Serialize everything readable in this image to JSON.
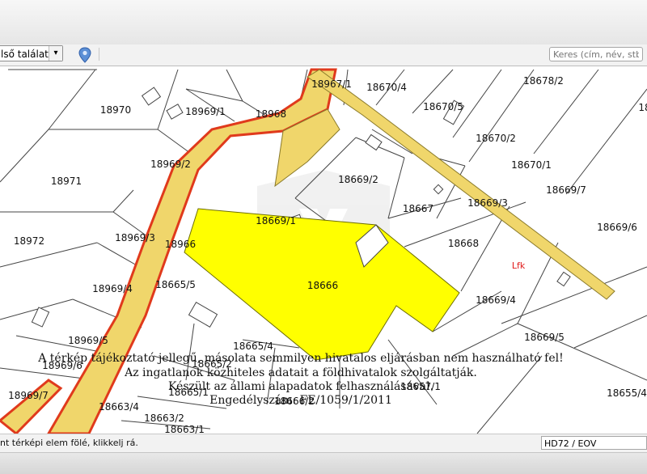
{
  "toolbar": {
    "select_value": "lső találat",
    "search_placeholder": "Keres (cím, név, stb.)",
    "icons": {
      "select_arrow": "chevron-down-icon",
      "location": "map-pin-icon"
    }
  },
  "map": {
    "parcels": [
      "18967/1",
      "18670/4",
      "18678/2",
      "18970",
      "18969/1",
      "18968",
      "18670/5",
      "18670/2",
      "18670/1",
      "18969/2",
      "18669/2",
      "18971",
      "18667",
      "18669/3",
      "18669/7",
      "18669/1",
      "18669/6",
      "18972",
      "18969/3",
      "18966",
      "18668",
      "Lfk",
      "18969/4",
      "18665/5",
      "18666",
      "18669/4",
      "18969/5",
      "18665/4",
      "18669/5",
      "18969/6",
      "18665/2",
      "18969/7",
      "18665/1",
      "18657/1",
      "18655/4",
      "18663/4",
      "18663/2",
      "18663/1",
      "18",
      "18666/2"
    ],
    "disclaimer": [
      "A térkép tájékoztató jellegű, másolata semmilyen hivatalos eljárásban nem használható fel!",
      "Az ingatlanok közhiteles adatait a földhivatalok szolgáltatják.",
      "Készült az állami alapadatok felhasználásával.",
      "Engedélyszám: FE/1059/1/2011"
    ],
    "colors": {
      "highlight": "#ffff00",
      "road": "#f0d66b",
      "road_border": "#e03a1c",
      "lines": "#444444"
    }
  },
  "statusbar": {
    "hint": "nt térképi elem fölé, klikkelj rá.",
    "projection": "HD72 / EOV"
  }
}
